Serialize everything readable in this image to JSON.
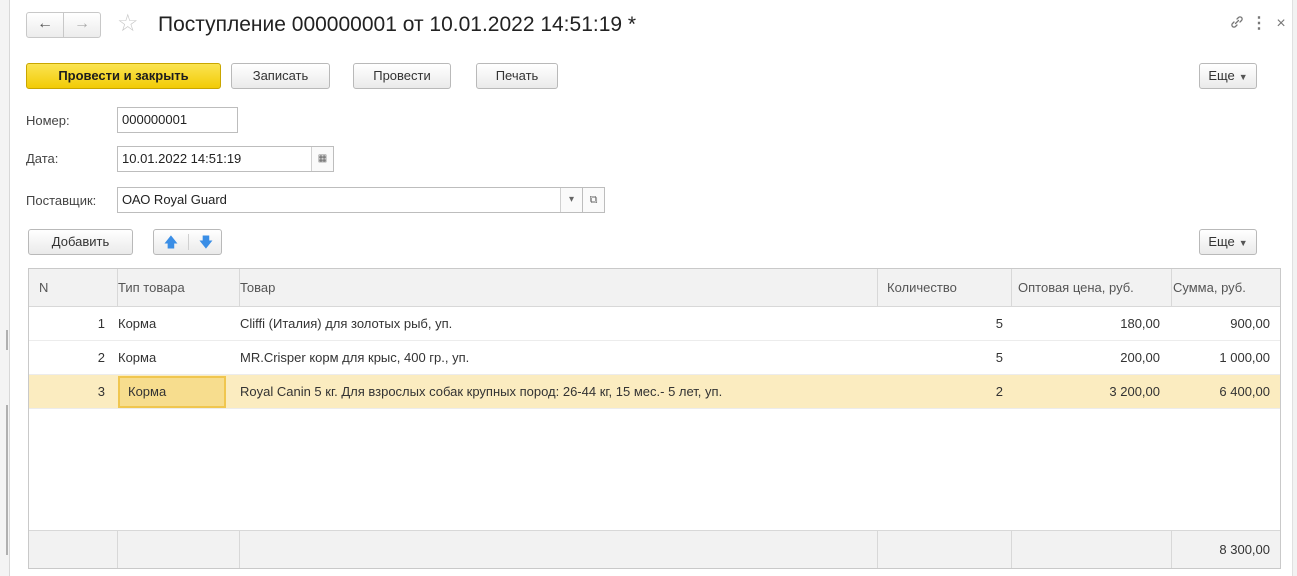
{
  "window": {
    "title": "Поступление 000000001 от 10.01.2022 14:51:19 *",
    "nav": {
      "back": "←",
      "forward": "→"
    },
    "star": "☆",
    "icons": {
      "link": "🔗",
      "menu": "⋮",
      "close": "×"
    }
  },
  "toolbar": {
    "post_and_close": "Провести и закрыть",
    "save": "Записать",
    "post": "Провести",
    "print": "Печать",
    "more": "Еще"
  },
  "form": {
    "number_label": "Номер:",
    "number_value": "000000001",
    "date_label": "Дата:",
    "date_value": "10.01.2022 14:51:19",
    "supplier_label": "Поставщик:",
    "supplier_value": "ОАО Royal Guard"
  },
  "table_toolbar": {
    "add": "Добавить",
    "up_icon": "🡅",
    "down_icon": "🡇",
    "more": "Еще"
  },
  "table": {
    "columns": [
      "N",
      "Тип товара",
      "Товар",
      "Количество",
      "Оптовая цена, руб.",
      "Сумма, руб."
    ],
    "rows": [
      {
        "n": "1",
        "type": "Корма",
        "item": "Cliffi (Италия) для золотых рыб, уп.",
        "qty": "5",
        "price": "180,00",
        "sum": "900,00"
      },
      {
        "n": "2",
        "type": "Корма",
        "item": "MR.Crisper корм для крыс, 400 гр., уп.",
        "qty": "5",
        "price": "200,00",
        "sum": "1 000,00"
      },
      {
        "n": "3",
        "type": "Корма",
        "item": "Royal Canin 5 кг. Для взрослых собак крупных пород: 26-44 кг, 15 мес.- 5 лет, уп.",
        "qty": "2",
        "price": "3 200,00",
        "sum": "6 400,00"
      }
    ],
    "selected_row": 3,
    "footer_total": "8 300,00"
  },
  "colors": {
    "primary_button": "#f5d320",
    "selected_row": "#fbecc0",
    "active_cell": "#f7dd8e",
    "arrow_blue": "#3a8ee6"
  }
}
